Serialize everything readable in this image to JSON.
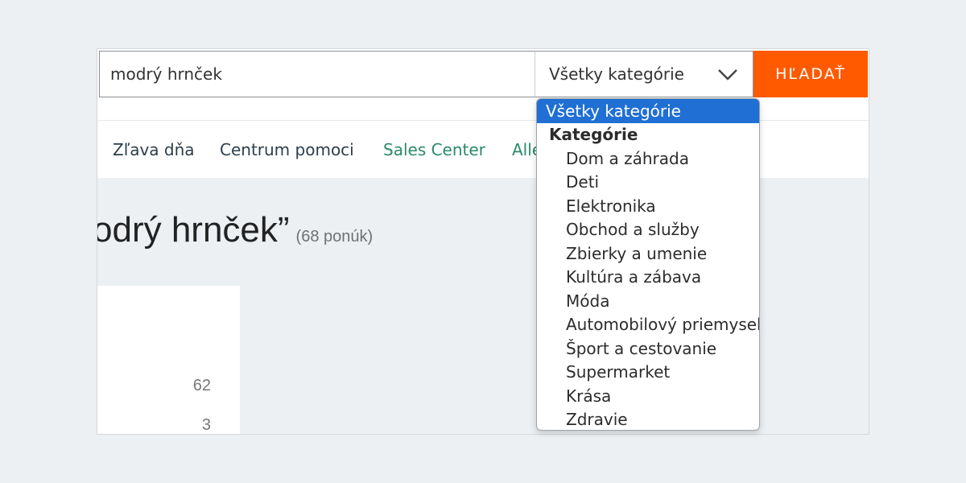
{
  "search": {
    "query": "modrý hrnček",
    "category_selected": "Všetky kategórie",
    "button_label": "HĽADAŤ"
  },
  "nav": {
    "items": [
      "Zľava dňa",
      "Centrum pomoci",
      "Sales Center",
      "Alle"
    ]
  },
  "results": {
    "title": "odrý hrnček”",
    "count": "(68 ponúk)"
  },
  "side_panel": {
    "numbers": [
      "62",
      "3"
    ]
  },
  "dropdown": {
    "selected": "Všetky kategórie",
    "group_label": "Kategórie",
    "options": [
      "Dom a záhrada",
      "Deti",
      "Elektronika",
      "Obchod a služby",
      "Zbierky a umenie",
      "Kultúra a zábava",
      "Móda",
      "Automobilový priemysel",
      "Šport a cestovanie",
      "Supermarket",
      "Krása",
      "Zdravie"
    ]
  },
  "colors": {
    "accent": "#ff5a00",
    "selection": "#1f6fd4",
    "link_green": "#2a8a6a"
  }
}
